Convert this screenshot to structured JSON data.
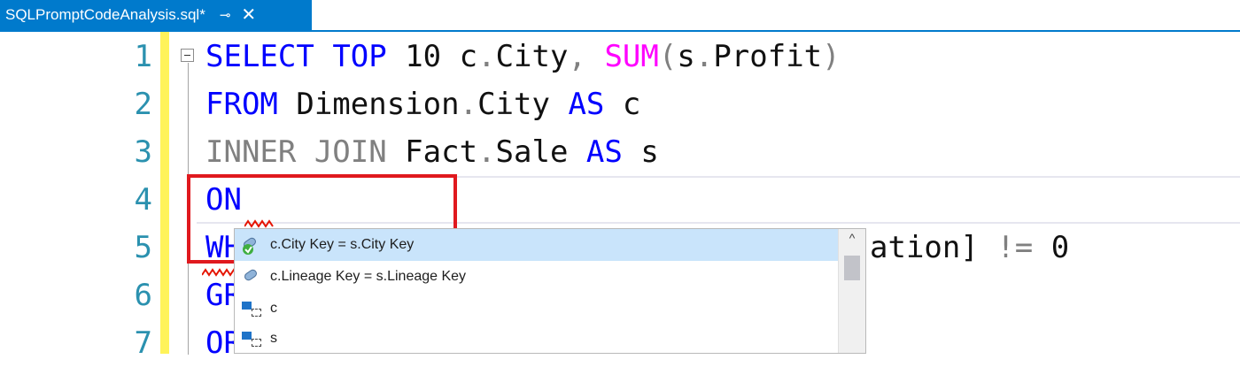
{
  "tab": {
    "title": "SQLPromptCodeAnalysis.sql*",
    "pin_glyph": "⊸",
    "close_glyph": "✕"
  },
  "colors": {
    "accent": "#007acc",
    "keyword": "#0000ff",
    "function": "#ff00ff",
    "gray_keyword": "#808080",
    "line_number": "#2b91af",
    "change_bar": "#fff35a",
    "highlight": "#e0191e",
    "selection": "#c9e4fb"
  },
  "gutter": [
    "1",
    "2",
    "3",
    "4",
    "5",
    "6",
    "7"
  ],
  "code": {
    "line1": {
      "select": "SELECT",
      "top": "TOP",
      "ten": " 10 c",
      "dot1": ".",
      "city": "City",
      "comma": ",",
      "sum": "SUM",
      "paren_open": "(",
      "sprof": "s",
      "dot2": ".",
      "profit": "Profit",
      "paren_close": ")"
    },
    "line2": {
      "from": "FROM",
      "dim": " Dimension",
      "dot": ".",
      "city": "City ",
      "as": "AS",
      "alias": " c"
    },
    "line3": {
      "inner_join": "INNER JOIN",
      "fact": " Fact",
      "dot": ".",
      "sale": "Sale ",
      "as": "AS",
      "alias": " s"
    },
    "line4": {
      "on": "ON"
    },
    "line5": {
      "prefix": "WH",
      "suffix": "ation]",
      "neq": " != ",
      "zero": "0"
    },
    "line6": {
      "prefix": "GR"
    },
    "line7": {
      "prefix": "OR"
    }
  },
  "completion": {
    "items": [
      {
        "label": "c.City Key = s.City Key",
        "icon": "join-icon",
        "selected": true
      },
      {
        "label": "c.Lineage Key = s.Lineage Key",
        "icon": "join-icon",
        "selected": false
      },
      {
        "label": "c",
        "icon": "table-alias-icon",
        "selected": false
      },
      {
        "label": "s",
        "icon": "table-alias-icon",
        "selected": false
      }
    ],
    "scroll_up_glyph": "^"
  }
}
